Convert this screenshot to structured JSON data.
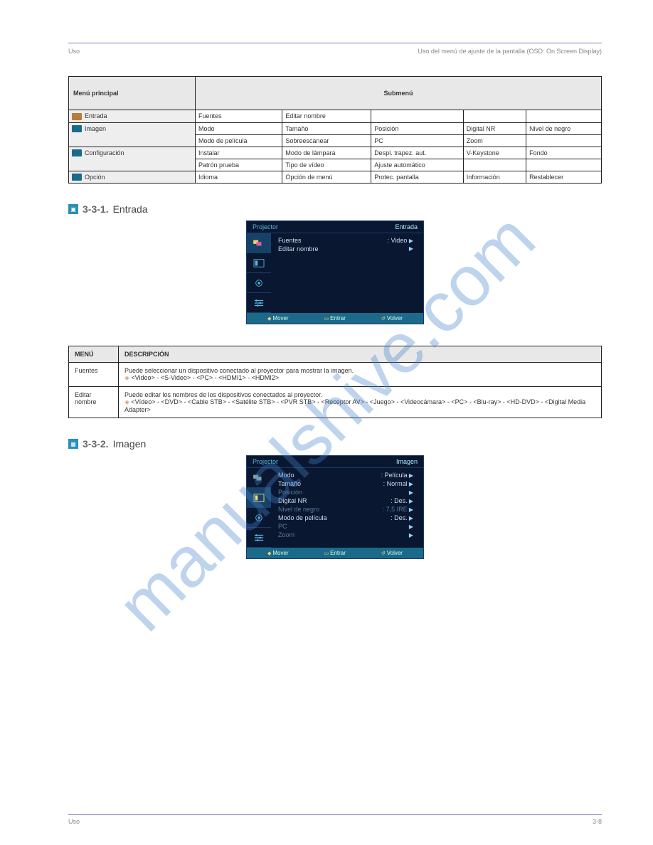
{
  "watermark": "manualshive.com",
  "header": {
    "left": "Uso",
    "right": "Uso del menú de ajuste de la pantalla (OSD: On Screen Display)"
  },
  "table1": {
    "th_menu": "Menú principal",
    "th_sub": "Submenú",
    "rows": [
      {
        "icon": "br",
        "label": "Entrada",
        "c": [
          "Fuentes",
          "Editar nombre",
          "",
          "",
          ""
        ]
      },
      {
        "icon": "tl",
        "label": "Imagen",
        "lines": [
          [
            "Modo",
            "Tamaño",
            "Posición",
            "Digital NR",
            "Nivel de negro"
          ],
          [
            "Modo de película",
            "Sobreescanear",
            "PC",
            "Zoom",
            ""
          ]
        ]
      },
      {
        "icon": "tl",
        "label": "Configuración",
        "lines": [
          [
            "Instalar",
            "Modo de lámpara",
            "Despl. trapez. aut.",
            "V-Keystone",
            "Fondo"
          ],
          [
            "Patrón prueba",
            "Tipo de vídeo",
            "Ajuste automático",
            "",
            ""
          ]
        ]
      },
      {
        "icon": "tl",
        "label": "Opción",
        "c": [
          "Idioma",
          "Opción de menú",
          "Protec. pantalla",
          "Información",
          "Restablecer"
        ]
      }
    ]
  },
  "sec_entrada": {
    "icon_name": "input-icon",
    "title": "Entrada",
    "osd": {
      "top_left": "Projector",
      "top_right": "Entrada",
      "rows": [
        {
          "label": "Fuentes",
          "value": ": Video",
          "arrow": "▶"
        },
        {
          "label": "Editar nombre",
          "value": "",
          "arrow": "▶"
        }
      ],
      "bottom": [
        "Mover",
        "Entrar",
        "Volver"
      ]
    },
    "table": {
      "th1": "MENÚ",
      "th2": "DESCRIPCIÓN",
      "r1_menu": "Fuentes",
      "r1_desc_line1": "Puede seleccionar un dispositivo conectado al proyector para mostrar la imagen.",
      "r1_desc_items": "<Video> - <S-Video> - <PC> - <HDMI1> - <HDMI2>",
      "r2_menu": "Editar nombre",
      "r2_desc_line1": "Puede editar los nombres de los dispositivos conectados al proyector.",
      "r2_desc_items": "<Vídeo> - <DVD> - <Cable STB> - <Satélite STB> - <PVR STB> - <Receptor AV> - <Juego> - <Videocámara> - <PC> - <Blu-ray> - <HD-DVD> - <Digital Media Adapter>"
    }
  },
  "sec_imagen": {
    "icon_name": "imagen-icon",
    "title": "Imagen",
    "osd": {
      "top_left": "Projector",
      "top_right": "Imagen",
      "rows": [
        {
          "label": "Modo",
          "value": ": Película",
          "arrow": "▶",
          "dim": false
        },
        {
          "label": "Tamaño",
          "value": ": Normal",
          "arrow": "▶",
          "dim": false
        },
        {
          "label": "Posición",
          "value": "",
          "arrow": "▶",
          "dim": true
        },
        {
          "label": "Digital NR",
          "value": ": Des.",
          "arrow": "▶",
          "dim": false
        },
        {
          "label": "Nivel de negro",
          "value": ": 7,5 IRE",
          "arrow": "▶",
          "dim": true
        },
        {
          "label": "Modo de película",
          "value": ": Des.",
          "arrow": "▶",
          "dim": false
        },
        {
          "label": "PC",
          "value": "",
          "arrow": "▶",
          "dim": true
        },
        {
          "label": "Zoom",
          "value": "",
          "arrow": "▶",
          "dim": true
        }
      ],
      "bottom": [
        "Mover",
        "Entrar",
        "Volver"
      ]
    }
  },
  "footer": {
    "left": "",
    "right": "3-8"
  }
}
